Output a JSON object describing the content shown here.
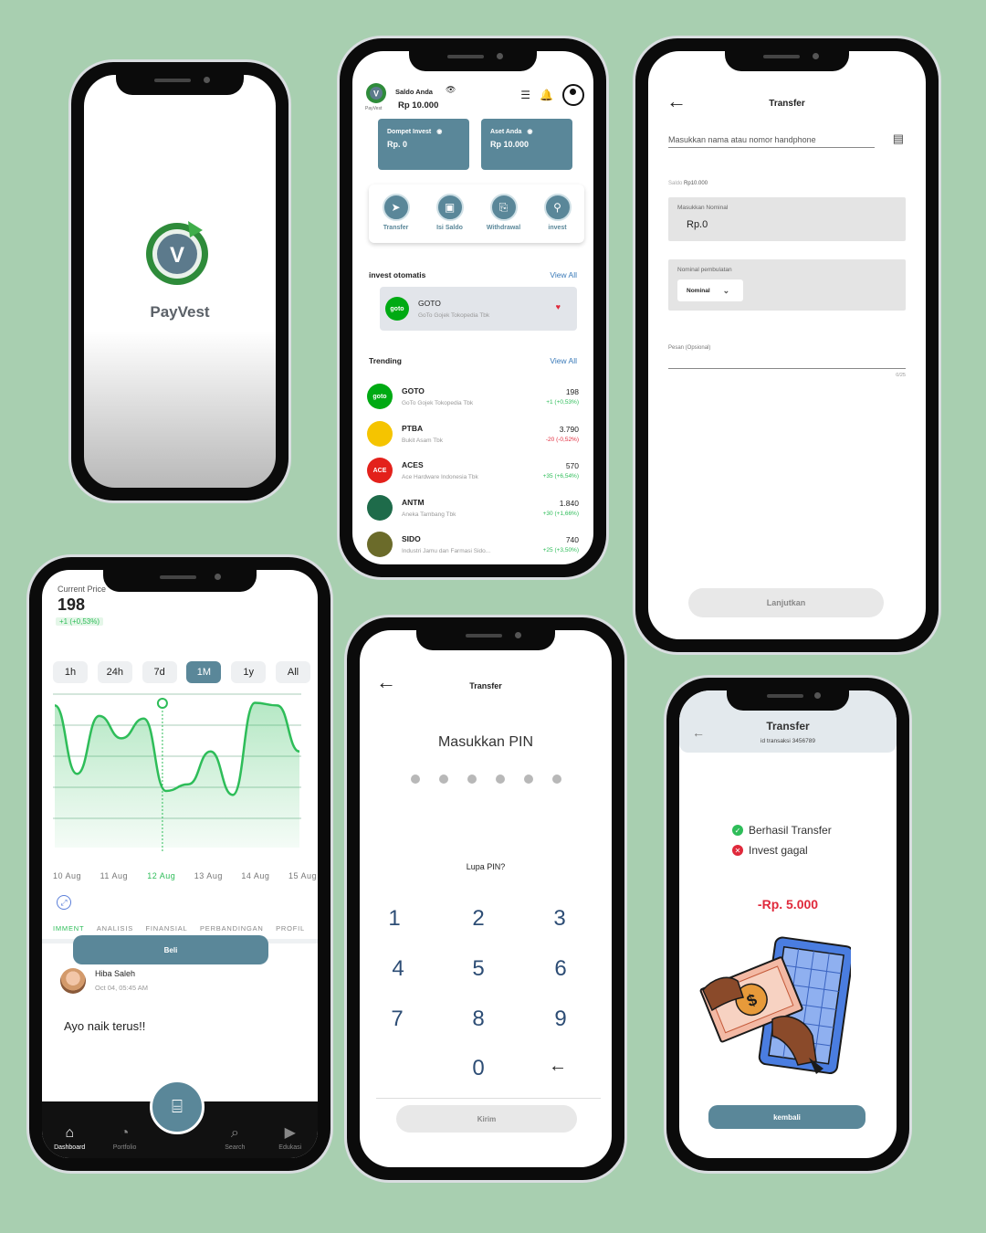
{
  "colors": {
    "background": "#a8cfb0",
    "accent": "#5a8799",
    "brand_green": "#2e8b3a",
    "positive": "#2ebd59",
    "negative": "#e0293b"
  },
  "splash": {
    "app_name": "PayVest",
    "logo_letter": "V"
  },
  "dashboard": {
    "saldo_label": "Saldo Anda",
    "saldo_value": "Rp 10.000",
    "brand_small": "PayVest",
    "cards": [
      {
        "title": "Dompet Invest",
        "value": "Rp. 0"
      },
      {
        "title": "Aset Anda",
        "value": "Rp 10.000"
      }
    ],
    "actions": [
      {
        "label": "Transfer",
        "icon": "send-icon"
      },
      {
        "label": "Isi Saldo",
        "icon": "topup-icon"
      },
      {
        "label": "Withdrawal",
        "icon": "withdraw-icon"
      },
      {
        "label": "invest",
        "icon": "invest-icon"
      }
    ],
    "auto_invest": {
      "title": "invest otomatis",
      "view_all": "View All",
      "item": {
        "ticker": "GOTO",
        "name": "GoTo Gojek Tokopedia Tbk",
        "logo_text": "goto"
      }
    },
    "trending": {
      "title": "Trending",
      "view_all": "View All",
      "items": [
        {
          "ticker": "GOTO",
          "name": "GoTo Gojek Tokopedia Tbk",
          "price": "198",
          "change": "+1 (+0,53%)",
          "logo_text": "goto",
          "color": "#00aa13",
          "positive": true
        },
        {
          "ticker": "PTBA",
          "name": "Bukit Asam Tbk",
          "price": "3.790",
          "change": "-20 (-0,52%)",
          "logo_text": "",
          "color": "#f5c400",
          "positive": false
        },
        {
          "ticker": "ACES",
          "name": "Ace Hardware Indonesia Tbk",
          "price": "570",
          "change": "+35 (+6,54%)",
          "logo_text": "ACE",
          "color": "#e3211b",
          "positive": true
        },
        {
          "ticker": "ANTM",
          "name": "Aneka Tambang Tbk",
          "price": "1.840",
          "change": "+30 (+1,66%)",
          "logo_text": "",
          "color": "#1e6b4a",
          "positive": true
        },
        {
          "ticker": "SIDO",
          "name": "Industri Jamu dan Farmasi Sido...",
          "price": "740",
          "change": "+25 (+3,50%)",
          "logo_text": "",
          "color": "#6b6b2a",
          "positive": true
        }
      ]
    }
  },
  "transfer_form": {
    "title": "Transfer",
    "recipient_placeholder": "Masukkan nama atau nomor handphone",
    "saldo_label": "Saldo",
    "saldo_value": "Rp10.000",
    "nominal_label": "Masukkan Nominal",
    "nominal_value": "Rp.0",
    "rounding_label": "Nominal pembulatan",
    "rounding_select": "Nominal",
    "message_label": "Pesan (Opsional)",
    "char_count": "0/25",
    "continue_button": "Lanjutkan"
  },
  "chart_screen": {
    "current_price_label": "Current Price",
    "price": "198",
    "change": "+1 (+0,53%)",
    "timeframes": [
      "1h",
      "24h",
      "7d",
      "1M",
      "1y",
      "All"
    ],
    "active_timeframe": "1M",
    "tabs": [
      "IMMENT",
      "ANALISIS",
      "FINANSIAL",
      "PERBANDINGAN",
      "PROFIL"
    ],
    "buy_button": "Beli",
    "comment": {
      "user": "Hiba Saleh",
      "time": "Oct 04, 05:45 AM",
      "text": "Ayo naik terus!!"
    },
    "nav": [
      "Dashboard",
      "Portfolio",
      "Search",
      "Edukasi"
    ]
  },
  "chart_data": {
    "type": "area",
    "x": [
      "10 Aug",
      "11 Aug",
      "12 Aug",
      "13 Aug",
      "14 Aug",
      "15 Aug"
    ],
    "highlight_x": "12 Aug",
    "series": [
      {
        "values": [
          0.9,
          0.38,
          0.82,
          0.65,
          0.8,
          0.25,
          0.3,
          0.55,
          0.22,
          0.92,
          0.9,
          0.55
        ]
      }
    ],
    "grid": true
  },
  "pin_screen": {
    "title": "Transfer",
    "heading": "Masukkan PIN",
    "pin_length": 6,
    "forgot": "Lupa PIN?",
    "keys": [
      "1",
      "2",
      "3",
      "4",
      "5",
      "6",
      "7",
      "8",
      "9",
      "0",
      "←"
    ],
    "submit": "Kirim"
  },
  "result_screen": {
    "title": "Transfer",
    "transaction_id": "id transaksi 3456789",
    "success_text": "Berhasil Transfer",
    "fail_text": "Invest gagal",
    "amount": "-Rp. 5.000",
    "back_button": "kembali"
  }
}
